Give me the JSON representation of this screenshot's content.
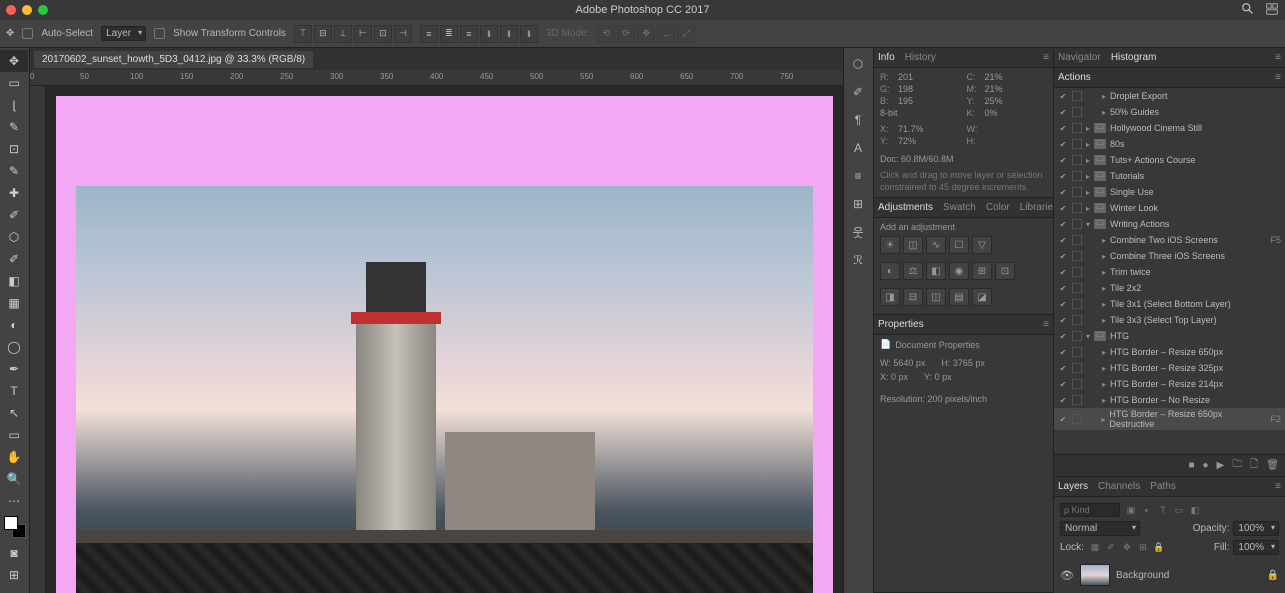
{
  "title": "Adobe Photoshop CC 2017",
  "options": {
    "auto_select": "Auto-Select",
    "layer_dropdown": "Layer",
    "show_transform": "Show Transform Controls",
    "threed_mode": "3D Mode:"
  },
  "document": {
    "tab": "20170602_sunset_howth_5D3_0412.jpg @ 33.3% (RGB/8)"
  },
  "ruler_marks": [
    "0",
    "50",
    "100",
    "150",
    "200",
    "250",
    "300",
    "350",
    "400",
    "450",
    "500",
    "550",
    "600",
    "650",
    "700",
    "750"
  ],
  "info": {
    "tab1": "Info",
    "tab2": "History",
    "r": "R:",
    "r_val": "201",
    "c": "C:",
    "c_val": "21%",
    "g": "G:",
    "g_val": "198",
    "m": "M:",
    "m_val": "21%",
    "b": "B:",
    "b_val": "195",
    "y": "Y:",
    "y_val": "25%",
    "bits": "8-bit",
    "k": "K:",
    "k_val": "0%",
    "x": "X:",
    "x_val": "71.7%",
    "w": "W:",
    "w_val": "",
    "yy": "Y:",
    "y_val2": "72%",
    "h": "H:",
    "h_val": "",
    "doc": "Doc: 60.8M/60.8M",
    "hint": "Click and drag to move layer or selection constrained to 45 degree increments."
  },
  "adjustments": {
    "tab1": "Adjustments",
    "tab2": "Swatch",
    "tab3": "Color",
    "tab4": "Libraries",
    "header": "Add an adjustment"
  },
  "properties": {
    "tab": "Properties",
    "header": "Document Properties",
    "w_lbl": "W:",
    "w_val": "5640 px",
    "h_lbl": "H:",
    "h_val": "3765 px",
    "x_lbl": "X:",
    "x_val": "0 px",
    "y_lbl": "Y:",
    "y_val": "0 px",
    "res": "Resolution: 200 pixels/inch"
  },
  "nav": {
    "tab1": "Navigator",
    "tab2": "Histogram"
  },
  "actions": {
    "tab": "Actions",
    "items": [
      {
        "label": "Droplet Export",
        "type": "action",
        "indent": 1
      },
      {
        "label": "50% Guides",
        "type": "action",
        "indent": 1
      },
      {
        "label": "Hollywood Cinema Still",
        "type": "folder",
        "indent": 0
      },
      {
        "label": "80s",
        "type": "folder",
        "indent": 0
      },
      {
        "label": "Tuts+ Actions Course",
        "type": "folder",
        "indent": 0
      },
      {
        "label": "Tutorials",
        "type": "folder",
        "indent": 0
      },
      {
        "label": "Single Use",
        "type": "folder",
        "indent": 0
      },
      {
        "label": "Winter Look",
        "type": "folder",
        "indent": 0
      },
      {
        "label": "Writing Actions",
        "type": "folder-open",
        "indent": 0
      },
      {
        "label": "Combine Two iOS Screens",
        "type": "action",
        "indent": 1,
        "shortcut": "F5"
      },
      {
        "label": "Combine Three iOS Screens",
        "type": "action",
        "indent": 1
      },
      {
        "label": "Trim twice",
        "type": "action",
        "indent": 1
      },
      {
        "label": "Tile 2x2",
        "type": "action",
        "indent": 1
      },
      {
        "label": "Tile 3x1 (Select Bottom Layer)",
        "type": "action",
        "indent": 1
      },
      {
        "label": "Tile 3x3 (Select Top Layer)",
        "type": "action",
        "indent": 1
      },
      {
        "label": "HTG",
        "type": "folder-open",
        "indent": 0
      },
      {
        "label": "HTG Border – Resize 650px",
        "type": "action",
        "indent": 1
      },
      {
        "label": "HTG Border – Resize 325px",
        "type": "action",
        "indent": 1
      },
      {
        "label": "HTG Border – Resize 214px",
        "type": "action",
        "indent": 1
      },
      {
        "label": "HTG Border – No Resize",
        "type": "action",
        "indent": 1
      },
      {
        "label": "HTG Border – Resize 650px Destructive",
        "type": "action",
        "indent": 1,
        "shortcut": "F2",
        "highlight": true
      }
    ]
  },
  "layers": {
    "tab1": "Layers",
    "tab2": "Channels",
    "tab3": "Paths",
    "search_placeholder": "ρ Kind",
    "blend": "Normal",
    "opacity_lbl": "Opacity:",
    "opacity": "100%",
    "lock_lbl": "Lock:",
    "fill_lbl": "Fill:",
    "fill": "100%",
    "bg": "Background"
  }
}
